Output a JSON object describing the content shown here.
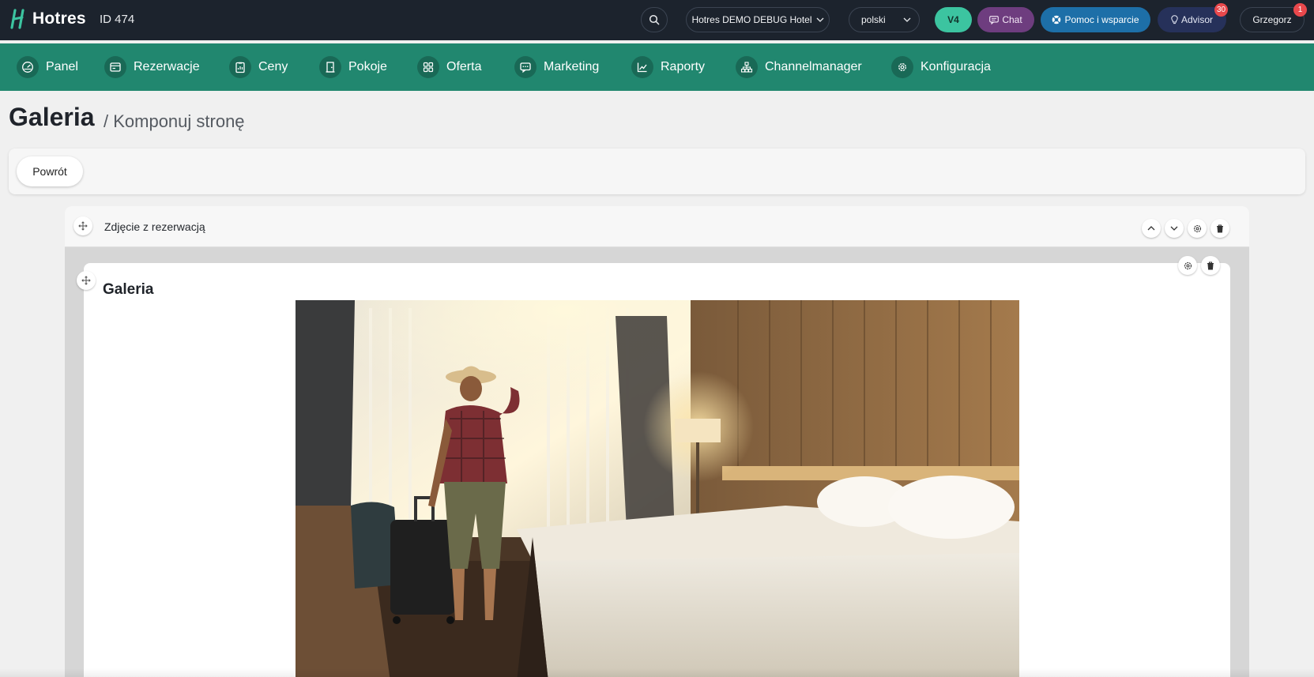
{
  "app": {
    "name": "Hotres",
    "hotel_id": "ID 474"
  },
  "topbar": {
    "search_icon": "search-icon",
    "hotel_select": "Hotres DEMO DEBUG Hotel",
    "language_select": "polski",
    "version_label": "V4",
    "chat_label": "Chat",
    "help_label": "Pomoc i wsparcie",
    "advisor_label": "Advisor",
    "advisor_badge": "30",
    "user_label": "Grzegorz",
    "user_badge": "1"
  },
  "nav": {
    "items": [
      {
        "label": "Panel",
        "icon": "dashboard-icon"
      },
      {
        "label": "Rezerwacje",
        "icon": "calendar-card-icon"
      },
      {
        "label": "Ceny",
        "icon": "price-list-icon"
      },
      {
        "label": "Pokoje",
        "icon": "door-icon"
      },
      {
        "label": "Oferta",
        "icon": "grid-icon"
      },
      {
        "label": "Marketing",
        "icon": "message-icon"
      },
      {
        "label": "Raporty",
        "icon": "chart-line-icon"
      },
      {
        "label": "Channelmanager",
        "icon": "network-icon"
      },
      {
        "label": "Konfiguracja",
        "icon": "gear-icon"
      }
    ]
  },
  "page": {
    "title": "Galeria",
    "subtitle": "/ Komponuj stronę"
  },
  "toolbar": {
    "back_label": "Powrót"
  },
  "section": {
    "title": "Zdjęcie z rezerwacją"
  },
  "block": {
    "title": "Galeria"
  },
  "colors": {
    "topbar_bg": "#1c232d",
    "nav_bg": "#21876f",
    "v4": "#3cc4a0",
    "chat": "#6e3d7f",
    "help": "#1d6fa8",
    "advisor": "#26315a",
    "badge": "#e8484c"
  }
}
